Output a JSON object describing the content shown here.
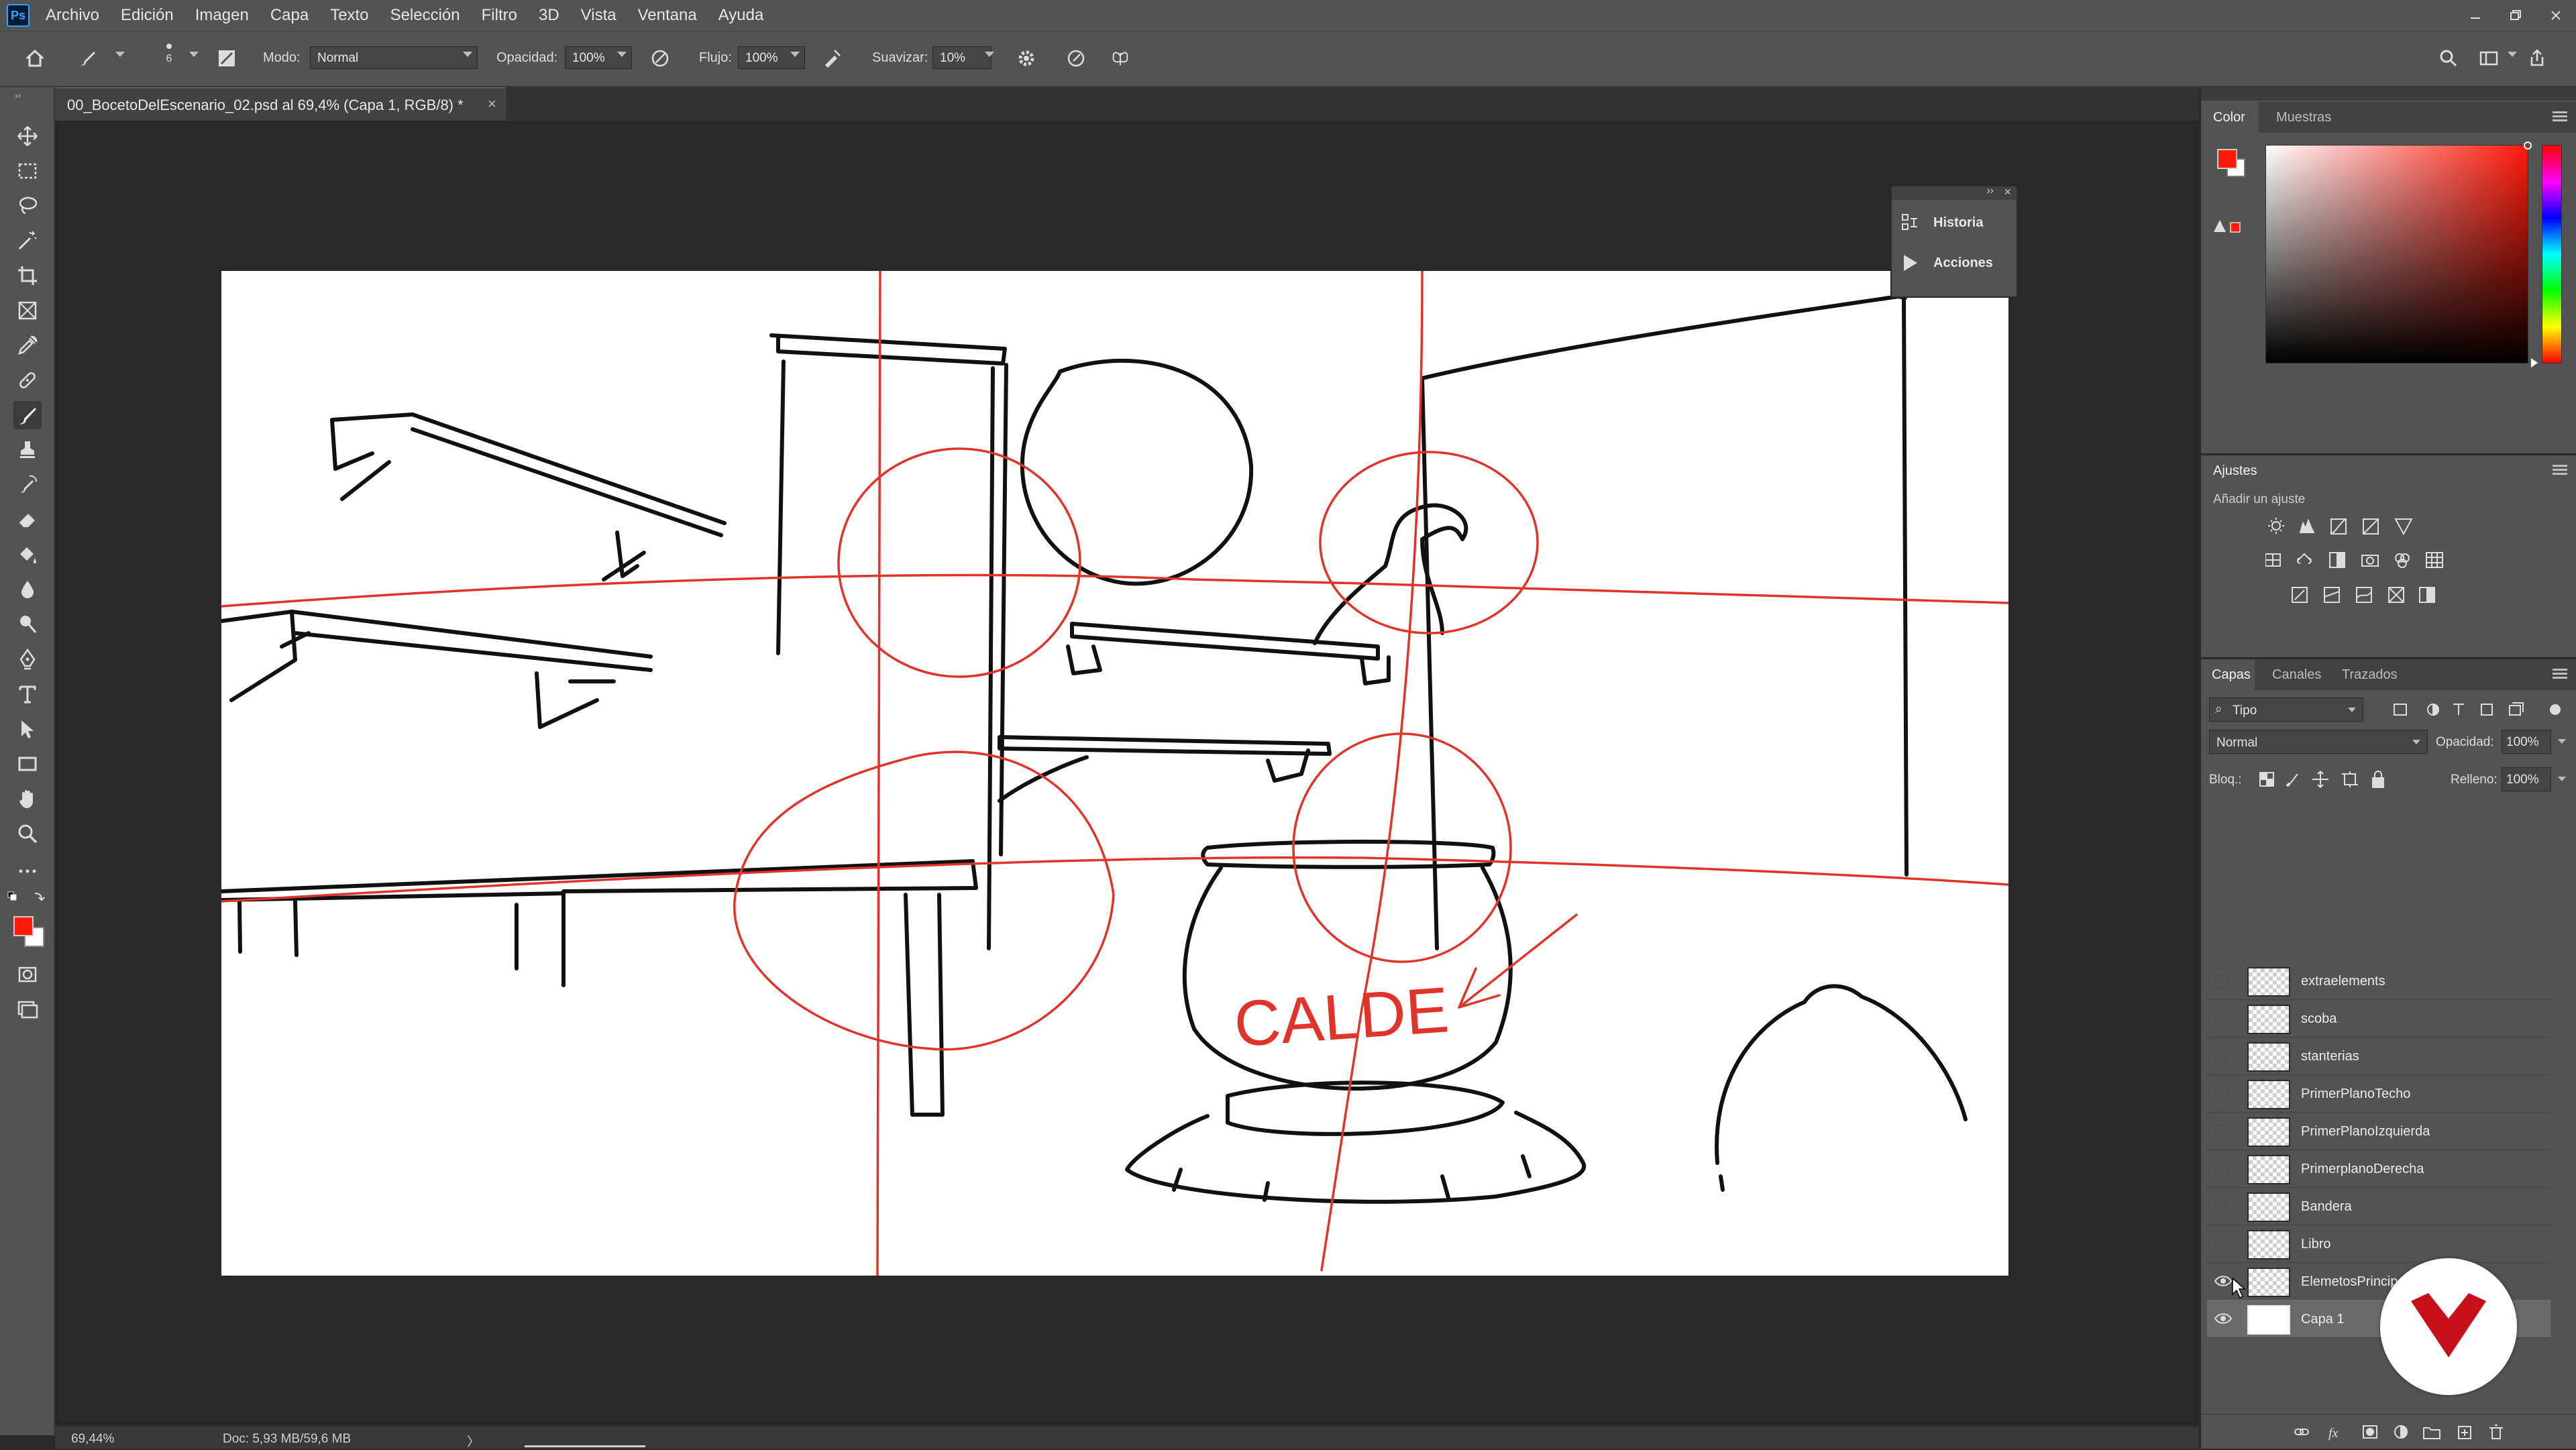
{
  "app": {
    "logo_text": "Ps"
  },
  "menubar": {
    "items": [
      "Archivo",
      "Edición",
      "Imagen",
      "Capa",
      "Texto",
      "Selección",
      "Filtro",
      "3D",
      "Vista",
      "Ventana",
      "Ayuda"
    ]
  },
  "options_bar": {
    "brush_size": "6",
    "mode_label": "Modo:",
    "mode_value": "Normal",
    "opacity_label": "Opacidad:",
    "opacity_value": "100%",
    "flow_label": "Flujo:",
    "flow_value": "100%",
    "smoothing_label": "Suavizar:",
    "smoothing_value": "10%"
  },
  "document": {
    "tab_title": "00_BocetoDelEscenario_02.psd al 69,4% (Capa 1, RGB/8) *"
  },
  "status_bar": {
    "zoom": "69,44%",
    "doc_info": "Doc: 5,93 MB/59,6 MB",
    "arrow": "〉"
  },
  "colors": {
    "foreground": "#ff1a0a",
    "background": "#ffffff",
    "sketch_red": "#e0342a"
  },
  "floating_panel": {
    "items": [
      {
        "label": "Historia",
        "icon": "history-icon"
      },
      {
        "label": "Acciones",
        "icon": "play-icon"
      }
    ]
  },
  "color_panel": {
    "tabs": [
      "Color",
      "Muestras"
    ]
  },
  "adjustments_panel": {
    "title": "Ajustes",
    "subtitle": "Añadir un ajuste"
  },
  "layers_panel": {
    "tabs": [
      "Capas",
      "Canales",
      "Trazados"
    ],
    "filter_label": "Tipo",
    "blend_mode": "Normal",
    "opacity_label": "Opacidad:",
    "opacity_value": "100%",
    "lock_label": "Bloq.:",
    "fill_label": "Relleno:",
    "fill_value": "100%",
    "layers": [
      {
        "name": "extraelements",
        "visible": false,
        "selected": false
      },
      {
        "name": "scoba",
        "visible": false,
        "selected": false
      },
      {
        "name": "stanterias",
        "visible": false,
        "selected": false
      },
      {
        "name": "PrimerPlanoTecho",
        "visible": false,
        "selected": false
      },
      {
        "name": "PrimerPlanoIzquierda",
        "visible": false,
        "selected": false
      },
      {
        "name": "PrimerplanoDerecha",
        "visible": false,
        "selected": false
      },
      {
        "name": "Bandera",
        "visible": false,
        "selected": false
      },
      {
        "name": "Libro",
        "visible": false,
        "selected": false
      },
      {
        "name": "ElemetosPrincip",
        "visible": true,
        "selected": false
      },
      {
        "name": "Capa 1",
        "visible": true,
        "selected": true
      }
    ]
  },
  "canvas_text": {
    "cauldron_label": "CALDE"
  }
}
